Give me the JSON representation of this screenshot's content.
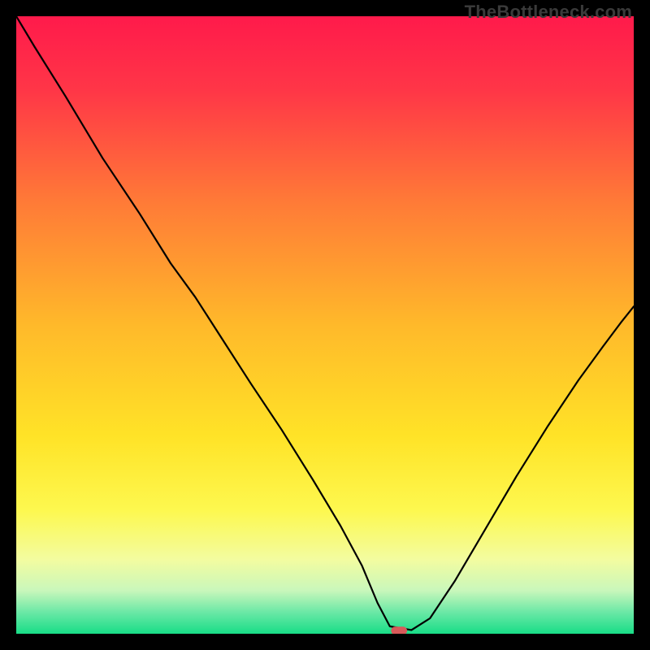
{
  "watermark": "TheBottleneck.com",
  "chart_data": {
    "type": "line",
    "title": "",
    "xlabel": "",
    "ylabel": "",
    "xlim": [
      0,
      100
    ],
    "ylim": [
      0,
      100
    ],
    "grid": false,
    "legend": false,
    "background_gradient_stops": [
      {
        "offset": 0.0,
        "color": "#ff1a4b"
      },
      {
        "offset": 0.12,
        "color": "#ff3647"
      },
      {
        "offset": 0.3,
        "color": "#ff7a37"
      },
      {
        "offset": 0.5,
        "color": "#ffb92a"
      },
      {
        "offset": 0.68,
        "color": "#ffe327"
      },
      {
        "offset": 0.8,
        "color": "#fdf84f"
      },
      {
        "offset": 0.88,
        "color": "#f3fca0"
      },
      {
        "offset": 0.93,
        "color": "#c9f7bb"
      },
      {
        "offset": 0.965,
        "color": "#6be8a6"
      },
      {
        "offset": 1.0,
        "color": "#18dd87"
      }
    ],
    "series": [
      {
        "name": "bottleneck-curve",
        "stroke": "#000000",
        "stroke_width": 2.2,
        "x": [
          0.0,
          3.0,
          8.0,
          14.0,
          20.0,
          25.0,
          29.0,
          33.5,
          38.0,
          43.0,
          48.0,
          52.5,
          56.0,
          58.5,
          60.5,
          64.0,
          67.0,
          71.0,
          76.0,
          81.0,
          86.0,
          91.0,
          95.0,
          98.0,
          100.0
        ],
        "y": [
          100.0,
          95.0,
          87.0,
          77.0,
          68.0,
          60.0,
          54.5,
          47.5,
          40.5,
          33.0,
          25.0,
          17.5,
          11.0,
          5.0,
          1.2,
          0.6,
          2.5,
          8.5,
          17.0,
          25.5,
          33.5,
          41.0,
          46.5,
          50.5,
          53.0
        ]
      }
    ],
    "markers": [
      {
        "name": "optimal-point",
        "shape": "rounded-rect",
        "x": 62.0,
        "y": 0.5,
        "width_pct": 2.6,
        "height_pct": 1.3,
        "fill": "#d85a5a"
      }
    ]
  }
}
